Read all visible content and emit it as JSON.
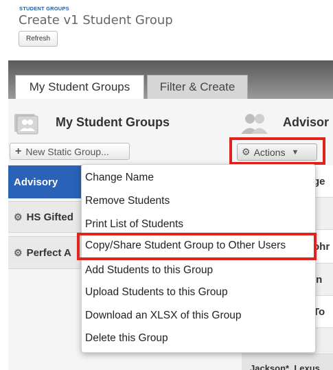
{
  "header": {
    "eyebrow": "STUDENT GROUPS",
    "title": "Create v1 Student Group",
    "refresh_label": "Refresh"
  },
  "tabs": [
    {
      "label": "My Student Groups",
      "active": true
    },
    {
      "label": "Filter & Create",
      "active": false
    }
  ],
  "left_panel": {
    "title": "My Student Groups",
    "new_group_label": "New Static Group...",
    "rows": [
      {
        "label": "Advisory",
        "selected": true
      },
      {
        "label": "HS Gifted"
      },
      {
        "label": "Perfect A"
      }
    ]
  },
  "right_panel": {
    "title": "Advisor",
    "actions_label": "Actions",
    "rows": [
      "ge",
      "",
      "ohr",
      "in",
      "To",
      ""
    ],
    "last_row": "Jackson*, Lexus"
  },
  "actions_menu": {
    "items": [
      "Change Name",
      "Remove Students",
      "Print List of Students",
      "Copy/Share Student Group to Other Users",
      "Add Students to this Group",
      "Upload Students to this Group",
      "Download an XLSX of this Group",
      "Delete this Group"
    ]
  },
  "colors": {
    "highlight": "#e0231c",
    "selected_row": "#2a62b7",
    "eyebrow": "#1f5fa8"
  },
  "icons": [
    "user-group-icon",
    "users-icon",
    "plus-icon",
    "gear-icon",
    "triangle-down-icon"
  ]
}
